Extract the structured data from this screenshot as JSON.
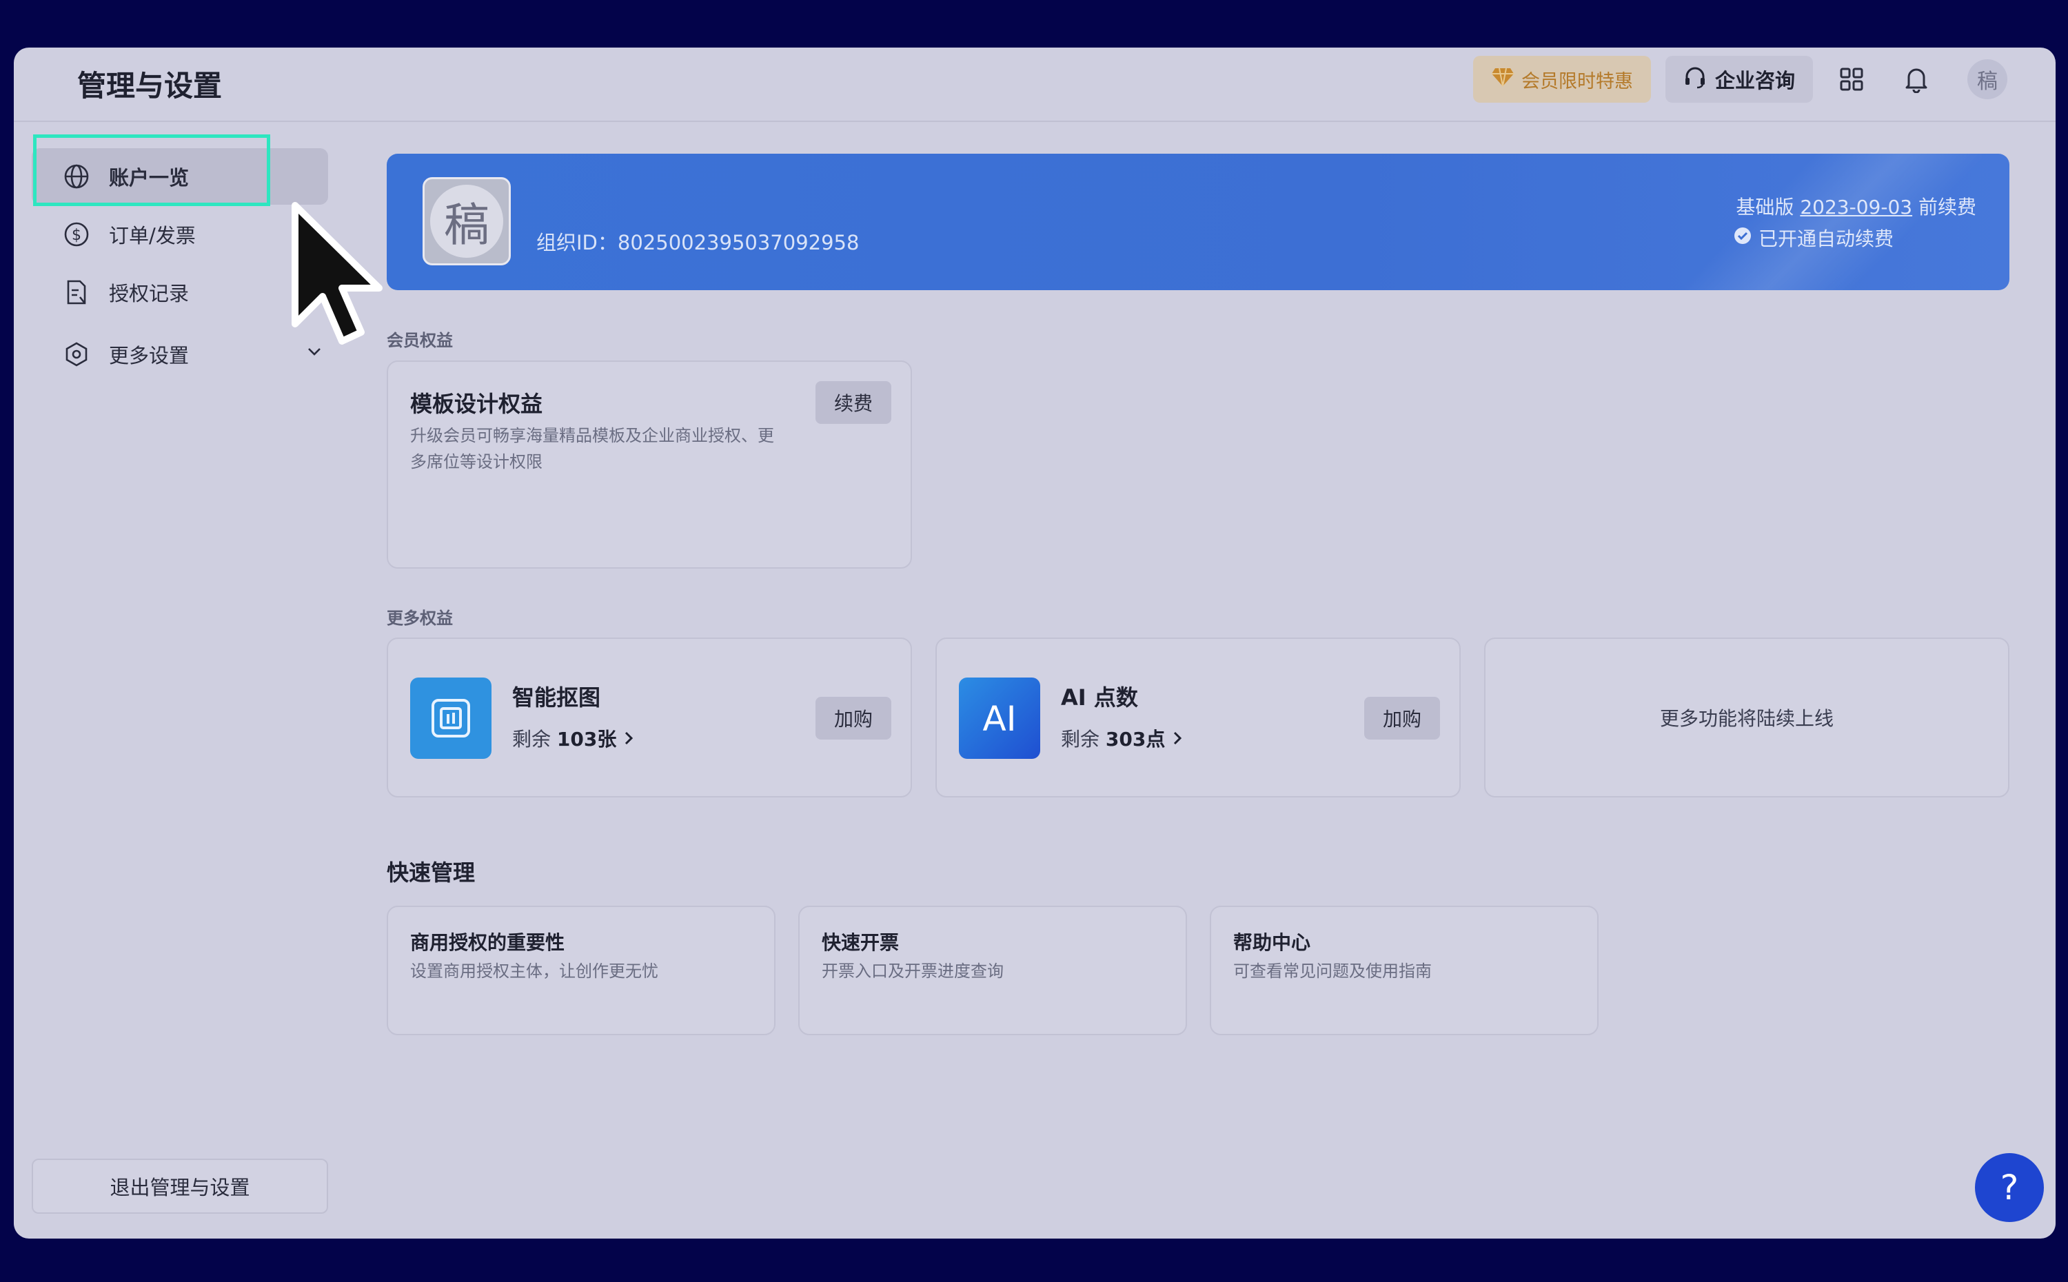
{
  "header": {
    "title": "管理与设置",
    "vip_label": "会员限时特惠",
    "consult_label": "企业咨询",
    "avatar_text": "稿"
  },
  "sidebar": {
    "items": [
      {
        "label": "账户一览",
        "icon": "globe-icon",
        "active": true
      },
      {
        "label": "订单/发票",
        "icon": "dollar-circle-icon",
        "active": false
      },
      {
        "label": "授权记录",
        "icon": "document-icon",
        "active": false
      },
      {
        "label": "更多设置",
        "icon": "gear-icon",
        "active": false
      }
    ],
    "exit_label": "退出管理与设置"
  },
  "banner": {
    "avatar_text": "稿",
    "org_id_label": "组织ID：",
    "org_id": "8025002395037092958",
    "plan_name": "基础版",
    "renew_date": "2023-09-03",
    "renew_suffix": "前续费",
    "auto_renew": "已开通自动续费"
  },
  "membership": {
    "section_label": "会员权益",
    "card_title": "模板设计权益",
    "card_desc_line1": "升级会员可畅享海量精品模板及企业商业授权、更",
    "card_desc_line2": "多席位等设计权限",
    "renew_button": "续费"
  },
  "more_benefits": {
    "section_label": "更多权益",
    "items": [
      {
        "title": "智能抠图",
        "remain_label": "剩余",
        "remain_value": "103张",
        "button": "加购",
        "icon": "cutout-icon"
      },
      {
        "title": "AI 点数",
        "remain_label": "剩余",
        "remain_value": "303点",
        "button": "加购",
        "icon": "ai-icon"
      }
    ],
    "coming_soon": "更多功能将陆续上线"
  },
  "quick_manage": {
    "title": "快速管理",
    "items": [
      {
        "title": "商用授权的重要性",
        "desc": "设置商用授权主体，让创作更无忧"
      },
      {
        "title": "快速开票",
        "desc": "开票入口及开票进度查询"
      },
      {
        "title": "帮助中心",
        "desc": "可查看常见问题及使用指南"
      }
    ]
  },
  "help_button": "?",
  "colors": {
    "accent": "#3b72d6",
    "highlight": "#2ee6c0",
    "help": "#1e45d0"
  }
}
